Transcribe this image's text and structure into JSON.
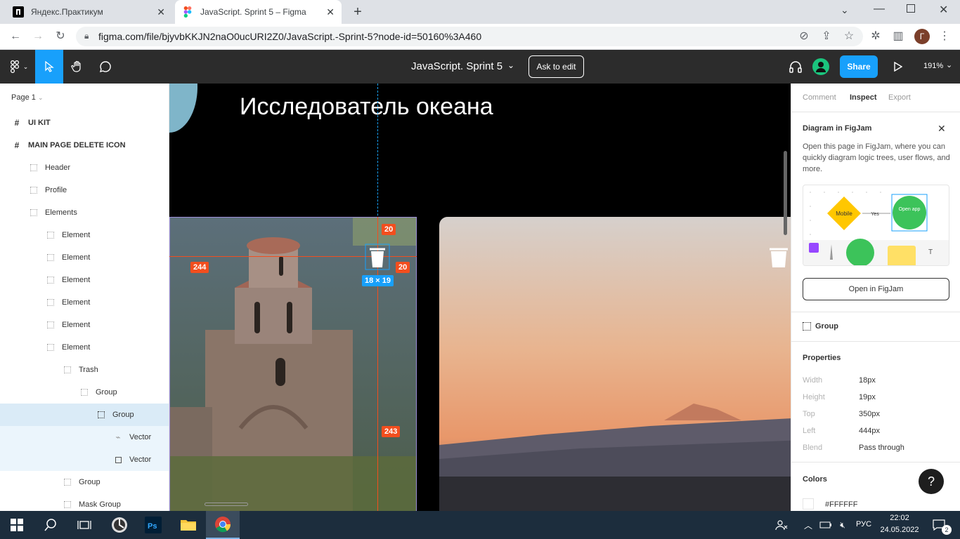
{
  "browser": {
    "tabs": [
      {
        "title": "Яндекс.Практикум",
        "active": false
      },
      {
        "title": "JavaScript. Sprint 5 – Figma",
        "active": true
      }
    ],
    "url": "figma.com/file/bjyvbKKJN2naO0ucURI2Z0/JavaScript.-Sprint-5?node-id=50160%3A460",
    "profile_initial": "Г"
  },
  "figma": {
    "file_title": "JavaScript. Sprint 5",
    "ask_to_edit": "Ask to edit",
    "share": "Share",
    "zoom": "191%",
    "page_selector": "Page 1"
  },
  "layers": [
    {
      "label": "UI KIT",
      "type": "frame",
      "indent": 0
    },
    {
      "label": "MAIN PAGE DELETE ICON",
      "type": "frame",
      "indent": 0
    },
    {
      "label": "Header",
      "type": "group",
      "indent": 1
    },
    {
      "label": "Profile",
      "type": "group",
      "indent": 1
    },
    {
      "label": "Elements",
      "type": "group",
      "indent": 1
    },
    {
      "label": "Element",
      "type": "group",
      "indent": 2
    },
    {
      "label": "Element",
      "type": "group",
      "indent": 2
    },
    {
      "label": "Element",
      "type": "group",
      "indent": 2
    },
    {
      "label": "Element",
      "type": "group",
      "indent": 2
    },
    {
      "label": "Element",
      "type": "group",
      "indent": 2
    },
    {
      "label": "Element",
      "type": "group",
      "indent": 2
    },
    {
      "label": "Trash",
      "type": "group",
      "indent": 3
    },
    {
      "label": "Group",
      "type": "group",
      "indent": 4
    },
    {
      "label": "Group",
      "type": "group",
      "indent": 5,
      "selected": true
    },
    {
      "label": "Vector",
      "type": "vector-line",
      "indent": 6,
      "child_selected": true
    },
    {
      "label": "Vector",
      "type": "vector-box",
      "indent": 6,
      "child_selected": true
    },
    {
      "label": "Group",
      "type": "group",
      "indent": 3
    },
    {
      "label": "Mask Group",
      "type": "group",
      "indent": 3
    }
  ],
  "canvas": {
    "heading": "Исследователь океана",
    "measure_top": "20",
    "measure_right": "20",
    "measure_left": "244",
    "measure_bottom": "243",
    "size_badge": "18 × 19"
  },
  "inspect": {
    "tabs": [
      "Comment",
      "Inspect",
      "Export"
    ],
    "active_tab": "Inspect",
    "figjam_title": "Diagram in FigJam",
    "figjam_desc": "Open this page in FigJam, where you can quickly diagram logic trees, user flows, and more.",
    "figjam_mobile": "Mobile",
    "figjam_yes": "Yes",
    "figjam_open_app": "Open app",
    "open_figjam": "Open in FigJam",
    "selection_name": "Group",
    "properties_title": "Properties",
    "properties": [
      {
        "label": "Width",
        "value": "18px"
      },
      {
        "label": "Height",
        "value": "19px"
      },
      {
        "label": "Top",
        "value": "350px"
      },
      {
        "label": "Left",
        "value": "444px"
      },
      {
        "label": "Blend",
        "value": "Pass through"
      }
    ],
    "colors_title": "Colors",
    "color_hex": "#FFFFFF",
    "help": "?"
  },
  "taskbar": {
    "lang": "РУС",
    "time": "22:02",
    "date": "24.05.2022",
    "notifications": "2"
  },
  "colors": {
    "figma_blue": "#18a0fb",
    "measure_red": "#f24e1e",
    "toolbar_dark": "#2c2c2c"
  }
}
